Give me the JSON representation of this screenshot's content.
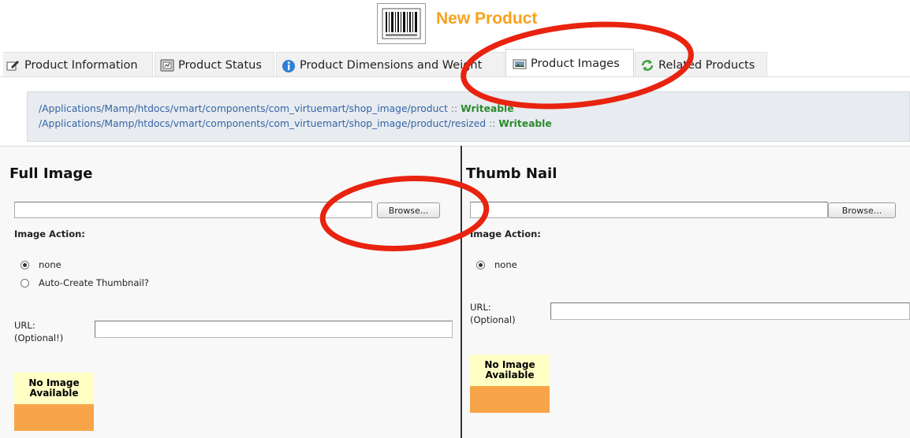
{
  "header": {
    "title": "New Product",
    "icon": "barcode-icon"
  },
  "tabs": [
    {
      "label": "Product Information",
      "icon": "edit-icon",
      "active": false
    },
    {
      "label": "Product Status",
      "icon": "status-icon",
      "active": false
    },
    {
      "label": "Product Dimensions and Weight",
      "icon": "info-icon",
      "active": false
    },
    {
      "label": "Product Images",
      "icon": "image-icon",
      "active": true
    },
    {
      "label": "Related Products",
      "icon": "refresh-icon",
      "active": false
    }
  ],
  "paths": [
    {
      "path": "/Applications/Mamp/htdocs/vmart/components/com_virtuemart/shop_image/product",
      "separator": "::",
      "status": "Writeable"
    },
    {
      "path": "/Applications/Mamp/htdocs/vmart/components/com_virtuemart/shop_image/product/resized",
      "separator": "::",
      "status": "Writeable"
    }
  ],
  "full_image": {
    "title": "Full Image",
    "browse_label": "Browse...",
    "image_action_label": "Image Action:",
    "options": [
      {
        "label": "none",
        "checked": true
      },
      {
        "label": "Auto-Create Thumbnail?",
        "checked": false
      }
    ],
    "url_label": "URL:\n(Optional!)",
    "url_value": "",
    "placeholder_text": "No Image Available"
  },
  "thumb_nail": {
    "title": "Thumb Nail",
    "browse_label": "Browse...",
    "image_action_label": "Image Action:",
    "options": [
      {
        "label": "none",
        "checked": true
      }
    ],
    "url_label": "URL:\n(Optional)",
    "url_value": "",
    "placeholder_text": "No Image Available"
  },
  "colors": {
    "title_orange": "#f7a21b",
    "writeable_green": "#2a8a2a",
    "path_blue": "#3464a4",
    "annotation_red": "#e8230f",
    "noimg_yellow": "#ffffc6",
    "noimg_orange": "#f8a54a"
  }
}
